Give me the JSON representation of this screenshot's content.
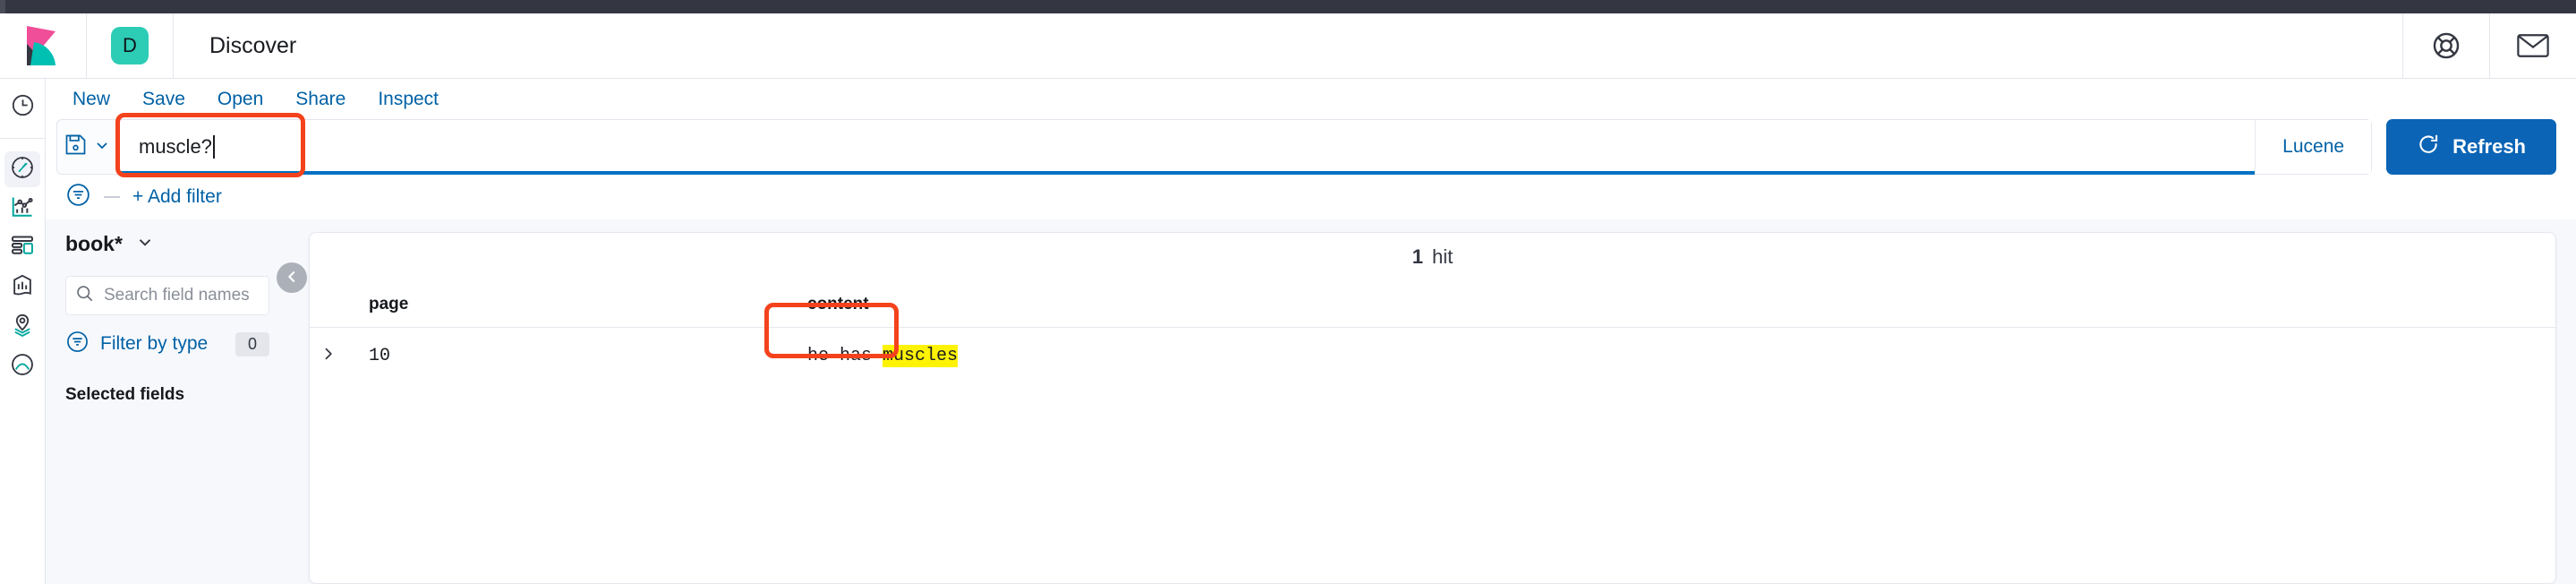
{
  "window": {
    "dark_strip_color": "#343741"
  },
  "header": {
    "logo_icon": "kibana-logo-icon",
    "space_badge_letter": "D",
    "space_badge_color": "#2DCCB5",
    "title": "Discover",
    "help_icon": "help-lifebuoy-icon",
    "mail_icon": "mail-envelope-icon"
  },
  "rail": {
    "items": [
      {
        "icon": "recently-viewed-clock-icon",
        "active": false
      },
      {
        "icon": "discover-compass-icon",
        "active": true
      },
      {
        "icon": "visualize-chart-icon",
        "active": false
      },
      {
        "icon": "dashboard-grid-icon",
        "active": false
      },
      {
        "icon": "canvas-presentation-icon",
        "active": false
      },
      {
        "icon": "maps-pin-layers-icon",
        "active": false
      },
      {
        "icon": "machine-learning-icon",
        "active": false
      }
    ]
  },
  "topnav": {
    "items": [
      {
        "label": "New"
      },
      {
        "label": "Save"
      },
      {
        "label": "Open"
      },
      {
        "label": "Share"
      },
      {
        "label": "Inspect"
      }
    ]
  },
  "query_bar": {
    "saved_query_icon": "save-floppy-icon",
    "saved_query_chevron_icon": "chevron-down-icon",
    "query_value": "muscle?",
    "query_placeholder": "Search",
    "language_label": "Lucene",
    "refresh_icon": "refresh-icon",
    "refresh_label": "Refresh",
    "refresh_color": "#0B64B5",
    "annotation_color": "#F4421C"
  },
  "filter_bar": {
    "filter_icon": "filter-circle-icon",
    "add_filter_label": "+ Add filter"
  },
  "sidebar": {
    "index_pattern": "book*",
    "index_pattern_chevron_icon": "chevron-down-icon",
    "field_search_placeholder": "Search field names",
    "field_search_value": "",
    "field_search_icon": "search-magnifier-icon",
    "filter_by_type_icon": "filter-circle-icon",
    "filter_by_type_label": "Filter by type",
    "filter_by_type_count": "0",
    "selected_fields_label": "Selected fields",
    "collapse_icon": "chevron-left-icon"
  },
  "results": {
    "hit_count": "1",
    "hit_label": "hit",
    "columns": [
      {
        "key": "page",
        "label": "page"
      },
      {
        "key": "content",
        "label": "content"
      }
    ],
    "rows": [
      {
        "expand_icon": "chevron-right-icon",
        "page": "10",
        "content_prefix": "he has ",
        "content_highlight": "muscles",
        "content_suffix": "",
        "highlight_color": "#FFF305"
      }
    ]
  }
}
